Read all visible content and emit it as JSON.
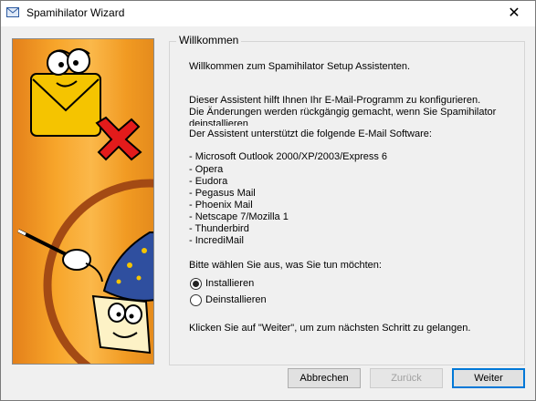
{
  "window": {
    "title": "Spamihilator Wizard",
    "close_glyph": "✕",
    "icon": "mail-icon"
  },
  "group": {
    "legend": "Willkommen"
  },
  "text": {
    "welcome": "Willkommen zum Spamihilator Setup Assistenten.",
    "intro1": "Dieser Assistent hilft Ihnen Ihr E-Mail-Programm zu konfigurieren.",
    "intro2": "Die Änderungen werden rückgängig gemacht, wenn Sie Spamihilator",
    "intro3": "deinstallieren",
    "support": "Der Assistent unterstützt die folgende E-Mail Software:",
    "clients": [
      "- Microsoft Outlook 2000/XP/2003/Express 6",
      "- Opera",
      "- Eudora",
      "- Pegasus Mail",
      "- Phoenix Mail",
      "- Netscape 7/Mozilla 1",
      "- Thunderbird",
      "- IncrediMail"
    ],
    "choose": "Bitte wählen Sie aus, was Sie tun möchten:",
    "next_hint": "Klicken Sie auf \"Weiter\", um zum nächsten Schritt zu gelangen."
  },
  "options": [
    {
      "label": "Installieren",
      "selected": true
    },
    {
      "label": "Deinstallieren",
      "selected": false
    }
  ],
  "buttons": {
    "cancel": "Abbrechen",
    "back": "Zurück",
    "next": "Weiter"
  },
  "colors": {
    "panel_orange": "#f39a1b",
    "envelope_yellow": "#f5c400",
    "wizard_blue": "#2f4f9f",
    "x_red": "#e31b1b"
  }
}
